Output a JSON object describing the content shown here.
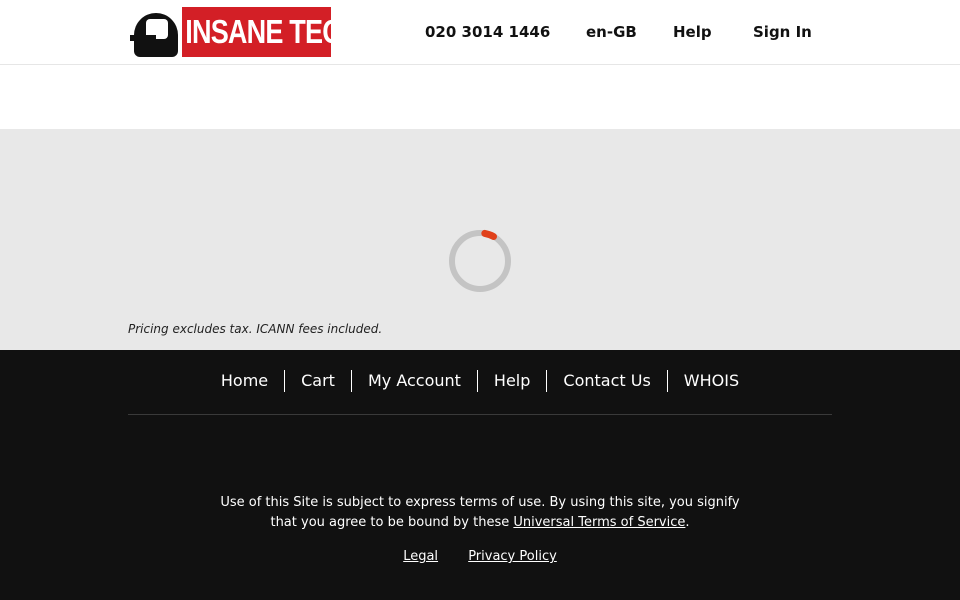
{
  "header": {
    "logo_text": "INSANE TECH",
    "phone": "020 3014 1446",
    "locale": "en-GB",
    "help": "Help",
    "sign_in": "Sign In"
  },
  "main": {
    "loading_indicator": "spinner",
    "pricing_note": "Pricing excludes tax. ICANN fees included."
  },
  "footer": {
    "links": [
      "Home",
      "Cart",
      "My Account",
      "Help",
      "Contact Us",
      "WHOIS"
    ],
    "terms_line1": "Use of this Site is subject to express terms of use. By using this site, you signify",
    "terms_line2_prefix": "that you agree to be bound by these ",
    "terms_link": "Universal Terms of Service",
    "terms_suffix": ".",
    "legal": "Legal",
    "privacy": "Privacy Policy"
  },
  "colors": {
    "brand_red": "#d31f26",
    "spinner_accent": "#e0401a",
    "spinner_track": "#c4c4c4",
    "footer_bg": "#111111",
    "main_bg": "#e8e8e8"
  }
}
